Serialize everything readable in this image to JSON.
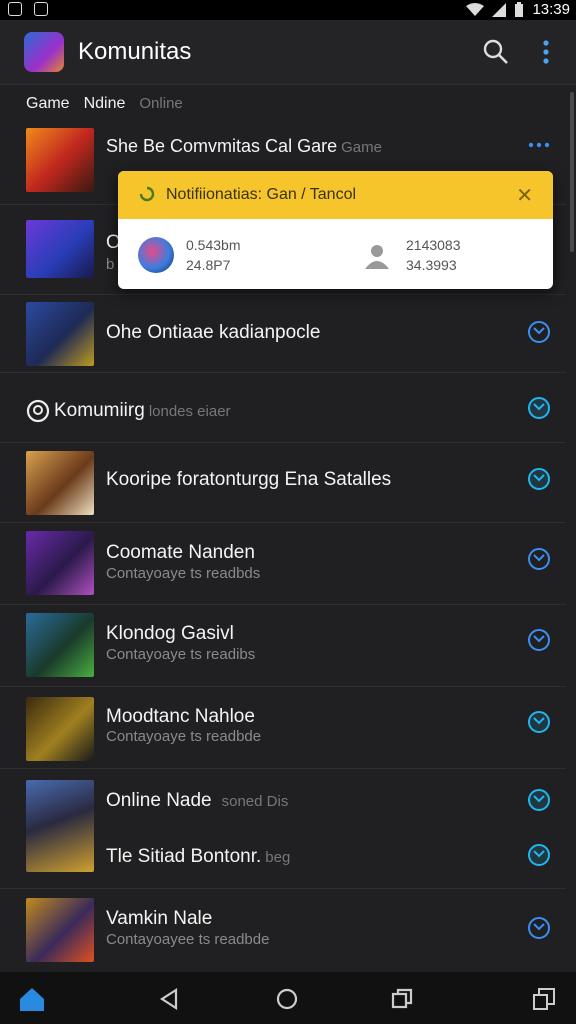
{
  "status": {
    "time": "13:39"
  },
  "appbar": {
    "title": "Komunitas"
  },
  "filters": {
    "items": [
      "Game",
      "Ndine"
    ],
    "dim": "Online"
  },
  "rows": [
    {
      "title": "She Be Comvmitas Cal Gare",
      "muted": "Game",
      "sub": ""
    },
    {
      "title": "O",
      "muted": "",
      "sub": "b"
    },
    {
      "title": "Ohe Ontiaae kadianpocle",
      "muted": "",
      "sub": ""
    },
    {
      "title": "Komumiirg",
      "muted": "londes eiaer",
      "sub": ""
    },
    {
      "title": "Kooripe foratonturgg Ena Satalles",
      "muted": "",
      "sub": ""
    },
    {
      "title": "Coomate Nanden",
      "muted": "",
      "sub": "Contayoaye ts readbds"
    },
    {
      "title": "Klondog Gasivl",
      "muted": "",
      "sub": "Contayoaye ts readibs"
    },
    {
      "title": "Moodtanc Nahloe",
      "muted": "",
      "sub": "Contayoaye ts readbde"
    },
    {
      "title": "Online Nade",
      "muted": "soned Dis",
      "sub": ""
    },
    {
      "title": "Tle Sitiad Bontonr.",
      "muted": "beg",
      "sub": ""
    },
    {
      "title": "Vamkin Nale",
      "muted": "",
      "sub": "Contayoayee ts readbde"
    }
  ],
  "popup": {
    "title": "Notifiionatias: Gan / Tancol",
    "left_top": "0.543bm",
    "left_bottom": "24.8P7",
    "right_top": "2143083",
    "right_bottom": "34.3993"
  },
  "colors": {
    "accent": "#3b8ff0",
    "accent_filled": "#1fb6ef",
    "popup_header": "#f5c52b"
  }
}
